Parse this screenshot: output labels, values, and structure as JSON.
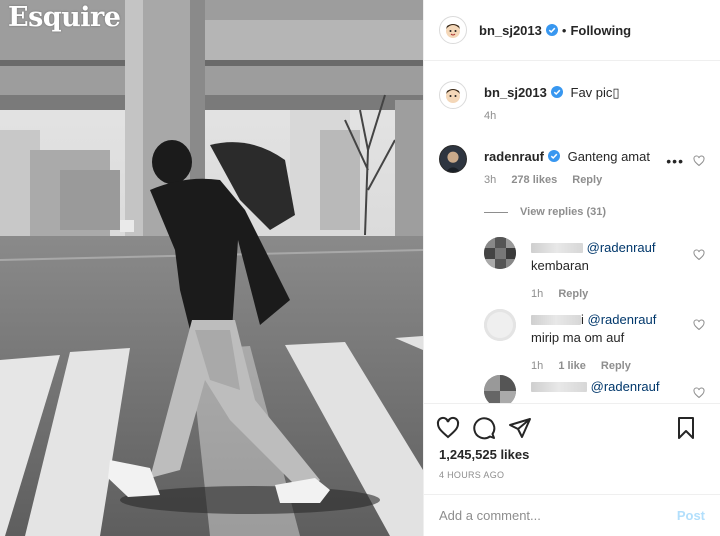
{
  "magazine": {
    "logo": "Esquire"
  },
  "header": {
    "username": "bn_sj2013",
    "separator": "•",
    "follow_status": "Following"
  },
  "caption": {
    "username": "bn_sj2013",
    "text": "Fav pic▯",
    "time": "4h"
  },
  "comments": [
    {
      "username": "radenrauf",
      "text": "Ganteng amat",
      "time": "3h",
      "likes": "278 likes",
      "reply": "Reply",
      "more": "•••"
    }
  ],
  "view_replies": "View replies (31)",
  "replies": [
    {
      "mention": "@radenrauf",
      "text": "kembaran",
      "time": "1h",
      "likes": "",
      "reply": "Reply"
    },
    {
      "mention": "@radenrauf",
      "prefix": "i",
      "text": "mirip ma om auf",
      "time": "1h",
      "likes": "1 like",
      "reply": "Reply"
    },
    {
      "mention": "@radenrauf",
      "text": "",
      "time": "",
      "likes": "",
      "reply": ""
    }
  ],
  "post": {
    "likes": "1,245,525 likes",
    "time_ago": "4 HOURS AGO"
  },
  "add_comment": {
    "placeholder": "Add a comment...",
    "post_label": "Post"
  },
  "colors": {
    "verified": "#3897f0",
    "link": "#00376b",
    "post_disabled": "#b2dffc"
  },
  "icons": [
    "heart-icon",
    "comment-icon",
    "share-icon",
    "bookmark-icon",
    "verified-badge-icon"
  ]
}
